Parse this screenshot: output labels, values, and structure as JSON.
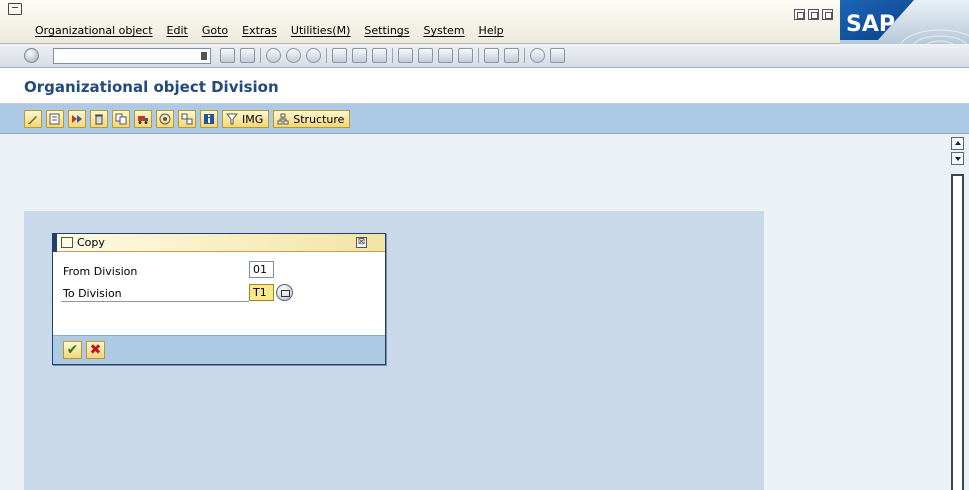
{
  "menubar": {
    "items": [
      "Organizational object",
      "Edit",
      "Goto",
      "Extras",
      "Utilities(M)",
      "Settings",
      "System",
      "Help"
    ]
  },
  "logo": {
    "text": "SAP"
  },
  "title": {
    "text": "Organizational object Division"
  },
  "app_toolbar": {
    "img_label": "IMG",
    "structure_label": "Structure"
  },
  "dialog": {
    "title": "Copy",
    "close_glyph": "⊠",
    "rows": [
      {
        "label": "From Division",
        "value": "01"
      },
      {
        "label": "To Division",
        "value": "T1"
      }
    ],
    "ok_glyph": "✔",
    "cancel_glyph": "✖"
  },
  "colors": {
    "accent": "#244a7d",
    "app_toolbar_bg": "#aec9e4",
    "active_field": "#fbe88a"
  }
}
